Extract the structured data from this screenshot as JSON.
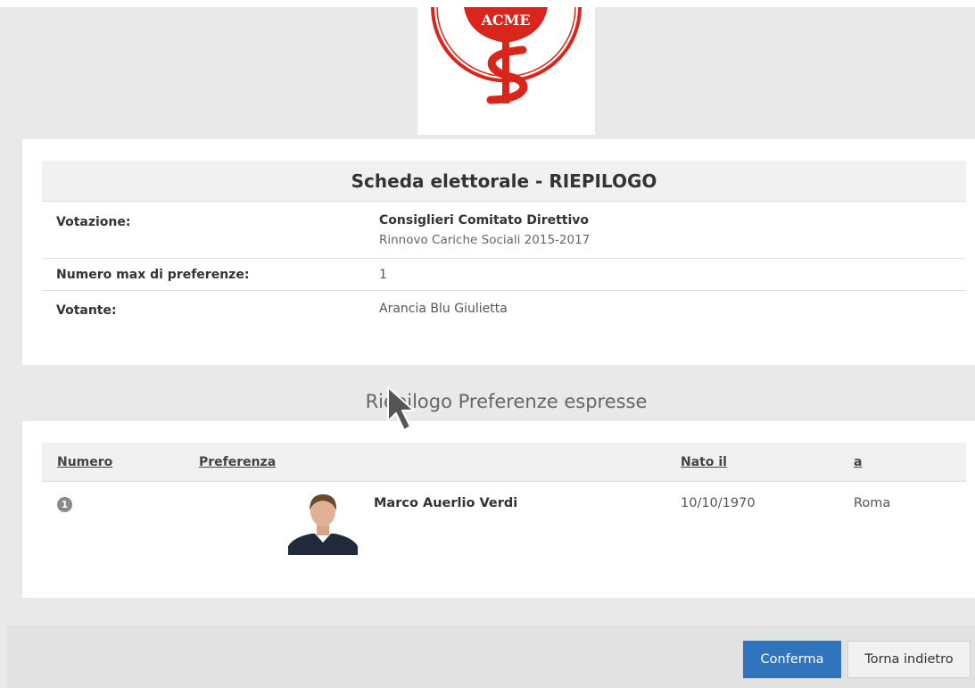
{
  "logo": {
    "text": "ACME",
    "color": "#d9261c"
  },
  "summary": {
    "title": "Scheda elettorale - RIEPILOGO",
    "rows": [
      {
        "label": "Votazione:",
        "value_main": "Consiglieri Comitato Direttivo",
        "value_sub": "Rinnovo Cariche Sociali 2015-2017"
      },
      {
        "label": "Numero max di preferenze:",
        "value": "1"
      },
      {
        "label": "Votante:",
        "value": "Arancia Blu Giulietta"
      }
    ]
  },
  "preferences": {
    "heading": "Riepilogo Preferenze espresse",
    "columns": {
      "number": "Numero",
      "preference": "Preferenza",
      "born_on": "Nato il",
      "born_in": "a"
    },
    "rows": [
      {
        "number": "1",
        "name": "Marco Auerlio Verdi",
        "born_on": "10/10/1970",
        "born_in": "Roma"
      }
    ]
  },
  "actions": {
    "confirm": "Conferma",
    "back": "Torna indietro"
  },
  "colors": {
    "primary": "#2f74bd",
    "accent": "#d9261c"
  }
}
